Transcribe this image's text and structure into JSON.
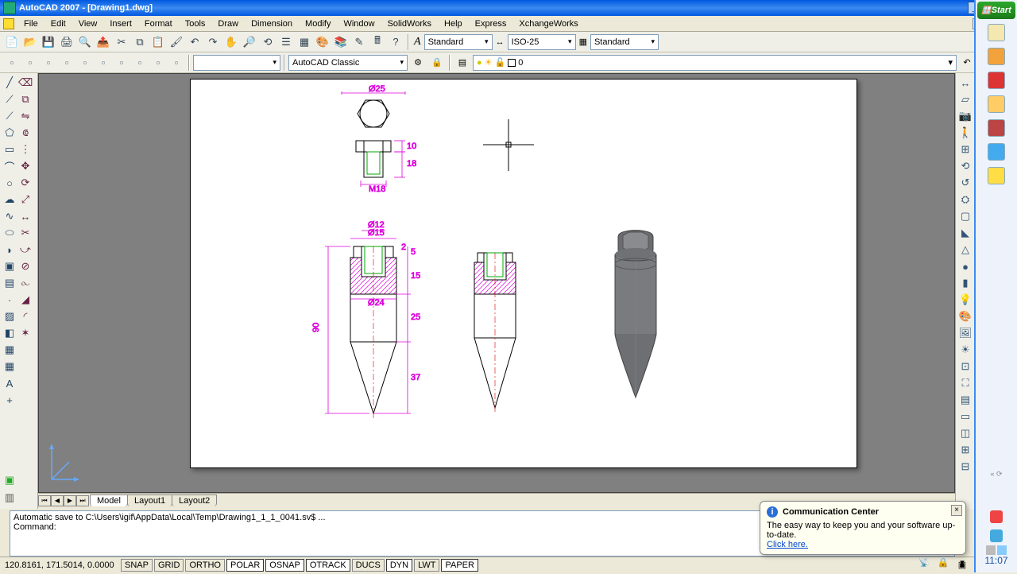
{
  "title": "AutoCAD 2007 - [Drawing1.dwg]",
  "menu": [
    "File",
    "Edit",
    "View",
    "Insert",
    "Format",
    "Tools",
    "Draw",
    "Dimension",
    "Modify",
    "Window",
    "SolidWorks",
    "Help",
    "Express",
    "XchangeWorks"
  ],
  "toolbars": {
    "text_style": "Standard",
    "dim_style": "ISO-25",
    "table_style": "Standard",
    "workspace": "AutoCAD Classic",
    "layer_name": "0"
  },
  "tabs": {
    "items": [
      "Model",
      "Layout1",
      "Layout2"
    ],
    "active": 0
  },
  "command": {
    "line1": "Automatic save to C:\\Users\\igif\\AppData\\Local\\Temp\\Drawing1_1_1_0041.sv$ ...",
    "line2": "Command:"
  },
  "status": {
    "coords": "120.8161, 171.5014, 0.0000",
    "toggles": [
      "SNAP",
      "GRID",
      "ORTHO",
      "POLAR",
      "OSNAP",
      "OTRACK",
      "DUCS",
      "DYN",
      "LWT",
      "PAPER"
    ],
    "active": [
      "POLAR",
      "OSNAP",
      "OTRACK",
      "DYN",
      "PAPER"
    ]
  },
  "balloon": {
    "title": "Communication Center",
    "body": "The easy way to keep you and your software up-to-date.",
    "link": "Click here."
  },
  "clock": "11:07",
  "start": "Start",
  "dims": {
    "top_width": "Ø25",
    "hex_w": "M18",
    "shaft_d": "Ø15",
    "inner_d": "Ø12",
    "body_d": "Ø24",
    "total_h": "90",
    "tip_h": "37",
    "mid_h": "25",
    "hatch_h": "15",
    "top_h": "10",
    "step": "2",
    "thread": "18",
    "lip": "5"
  }
}
